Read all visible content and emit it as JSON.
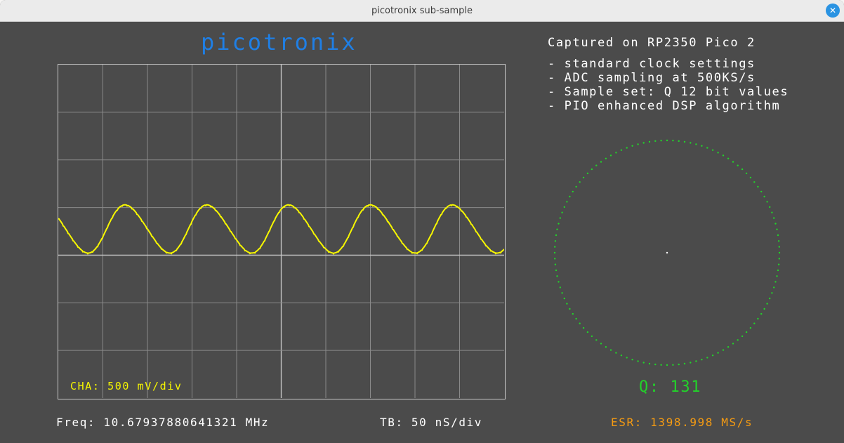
{
  "window": {
    "title": "picotronix sub-sample",
    "close_icon": "close-icon"
  },
  "brand": "picotronix",
  "scope": {
    "channel_label": "CHA: 500 mV/div",
    "frequency": "Freq: 10.67937880641321 MHz",
    "timebase": "TB: 50 nS/div",
    "divisions": {
      "x": 10,
      "y": 7
    },
    "trace": {
      "color": "#f7f700",
      "cycles_shown": 5.45,
      "center_div": 3.45,
      "amplitude_div": 0.5
    },
    "grid_color": "#8a8a8a",
    "border_color": "#c8c8c8"
  },
  "info": {
    "heading": "Captured on RP2350 Pico 2",
    "bullets": [
      "- standard clock settings",
      "- ADC sampling at 500KS/s",
      "- Sample set: Q 12 bit values",
      "- PIO enhanced DSP algorithm"
    ]
  },
  "phase": {
    "dot_color": "#22d22a",
    "dot_count": 120,
    "q_label": "Q: 131"
  },
  "esr": "ESR: 1398.998 MS/s",
  "colors": {
    "brand": "#1f7fe5",
    "background": "#4b4b4b",
    "trace": "#f7f700",
    "esr": "#f59b12",
    "q": "#22d22a"
  }
}
